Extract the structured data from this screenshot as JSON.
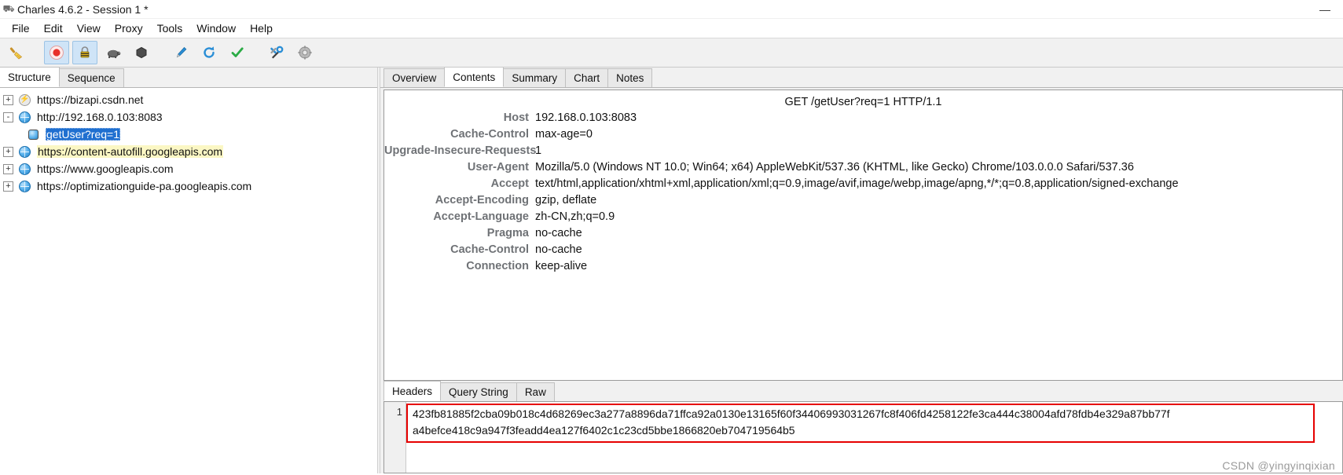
{
  "window": {
    "title": "Charles 4.6.2 - Session 1 *",
    "app_icon": "charles-app-icon",
    "minimize_label": "—"
  },
  "menubar": {
    "items": [
      "File",
      "Edit",
      "View",
      "Proxy",
      "Tools",
      "Window",
      "Help"
    ]
  },
  "toolbar": {
    "buttons": [
      {
        "name": "clear-session-icon",
        "glyph": "broom-icon",
        "active": false
      },
      {
        "name": "record-icon",
        "glyph": "record-icon",
        "active": true
      },
      {
        "name": "ssl-proxying-icon",
        "glyph": "lock-icon",
        "active": true
      },
      {
        "name": "throttle-icon",
        "glyph": "turtle-icon",
        "active": false
      },
      {
        "name": "breakpoints-icon",
        "glyph": "hexagon-icon",
        "active": false
      },
      {
        "name": "compose-icon",
        "glyph": "pen-icon",
        "active": false
      },
      {
        "name": "repeat-icon",
        "glyph": "refresh-icon",
        "active": false
      },
      {
        "name": "validate-icon",
        "glyph": "checkmark-icon",
        "active": false
      },
      {
        "name": "tools-icon",
        "glyph": "wrench-icon",
        "active": false
      },
      {
        "name": "settings-icon",
        "glyph": "gear-icon",
        "active": false
      }
    ]
  },
  "left_panel": {
    "tabs": [
      {
        "label": "Structure",
        "active": true
      },
      {
        "label": "Sequence",
        "active": false
      }
    ],
    "tree": [
      {
        "label": "https://bizapi.csdn.net",
        "expander": "+",
        "icon": "bolt-icon",
        "indent": 0,
        "state": "normal"
      },
      {
        "label": "http://192.168.0.103:8083",
        "expander": "-",
        "icon": "globe-icon",
        "indent": 0,
        "state": "normal"
      },
      {
        "label": "getUser?req=1",
        "expander": "",
        "icon": "request-icon",
        "indent": 1,
        "state": "selected"
      },
      {
        "label": "https://content-autofill.googleapis.com",
        "expander": "+",
        "icon": "globe-icon",
        "indent": 0,
        "state": "highlight"
      },
      {
        "label": "https://www.googleapis.com",
        "expander": "+",
        "icon": "globe-icon",
        "indent": 0,
        "state": "normal"
      },
      {
        "label": "https://optimizationguide-pa.googleapis.com",
        "expander": "+",
        "icon": "globe-icon",
        "indent": 0,
        "state": "normal"
      }
    ]
  },
  "right_panel": {
    "tabs": [
      {
        "label": "Overview",
        "active": false
      },
      {
        "label": "Contents",
        "active": true
      },
      {
        "label": "Summary",
        "active": false
      },
      {
        "label": "Chart",
        "active": false
      },
      {
        "label": "Notes",
        "active": false
      }
    ],
    "request_line": "GET /getUser?req=1 HTTP/1.1",
    "headers": [
      {
        "name": "Host",
        "value": "192.168.0.103:8083"
      },
      {
        "name": "Cache-Control",
        "value": "max-age=0"
      },
      {
        "name": "Upgrade-Insecure-Requests",
        "value": "1"
      },
      {
        "name": "User-Agent",
        "value": "Mozilla/5.0 (Windows NT 10.0; Win64; x64) AppleWebKit/537.36 (KHTML, like Gecko) Chrome/103.0.0.0 Safari/537.36"
      },
      {
        "name": "Accept",
        "value": "text/html,application/xhtml+xml,application/xml;q=0.9,image/avif,image/webp,image/apng,*/*;q=0.8,application/signed-exchange"
      },
      {
        "name": "Accept-Encoding",
        "value": "gzip, deflate"
      },
      {
        "name": "Accept-Language",
        "value": "zh-CN,zh;q=0.9"
      },
      {
        "name": "Pragma",
        "value": "no-cache"
      },
      {
        "name": "Cache-Control",
        "value": "no-cache"
      },
      {
        "name": "Connection",
        "value": "keep-alive"
      }
    ]
  },
  "bottom_panel": {
    "tabs": [
      {
        "label": "Headers",
        "active": true
      },
      {
        "label": "Query String",
        "active": false
      },
      {
        "label": "Raw",
        "active": false
      }
    ],
    "line_number": "1",
    "content_line_1": "423fb81885f2cba09b018c4d68269ec3a277a8896da71ffca92a0130e13165f60f34406993031267fc8f406fd4258122fe3ca444c38004afd78fdb4e329a87bb77f",
    "content_line_2": "a4befce418c9a947f3feadd4ea127f6402c1c23cd5bbe1866820eb704719564b5",
    "highlight_color": "#e60000"
  },
  "watermark": "CSDN @yingyinqixian"
}
